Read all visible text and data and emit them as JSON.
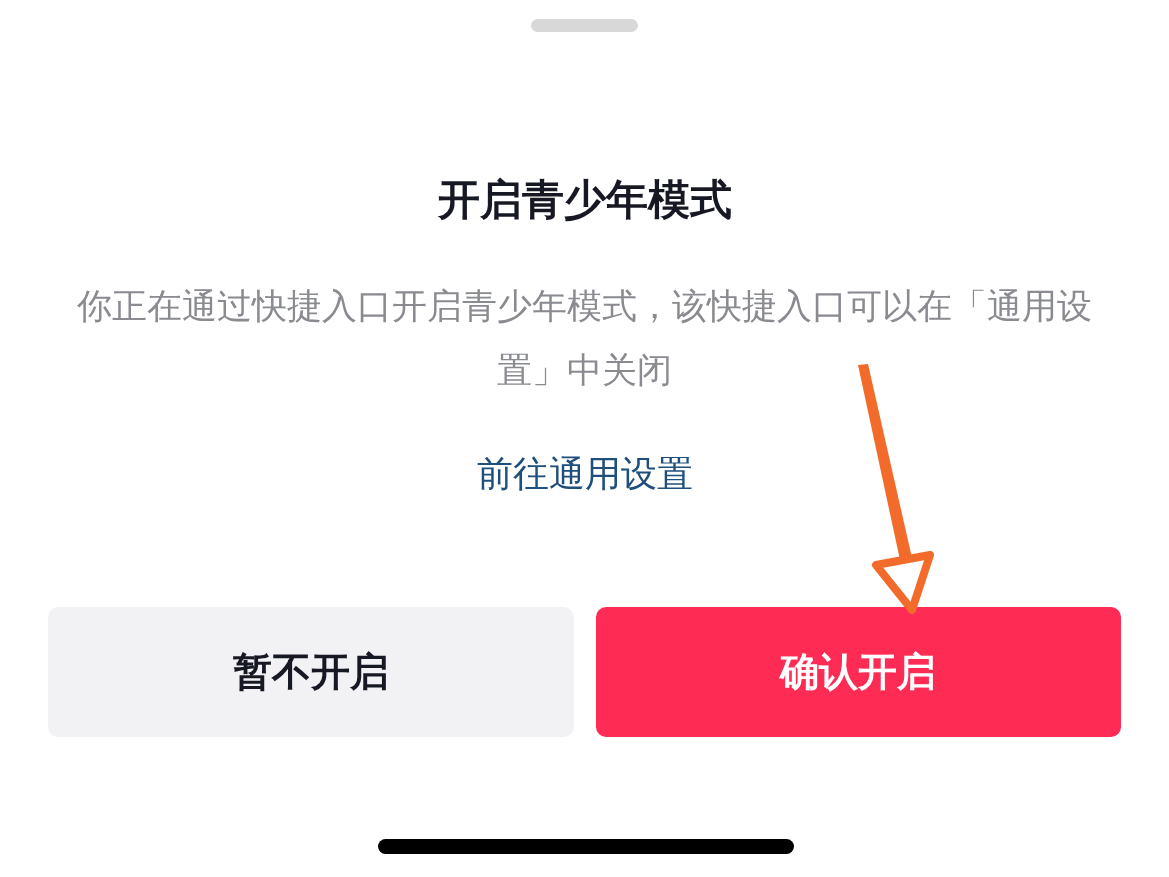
{
  "dialog": {
    "title": "开启青少年模式",
    "message": "你正在通过快捷入口开启青少年模式，该快捷入口可以在「通用设置」中关闭",
    "link": "前往通用设置",
    "buttons": [
      {
        "label": "暂不开启",
        "kind": "secondary"
      },
      {
        "label": "确认开启",
        "kind": "primary"
      }
    ]
  }
}
